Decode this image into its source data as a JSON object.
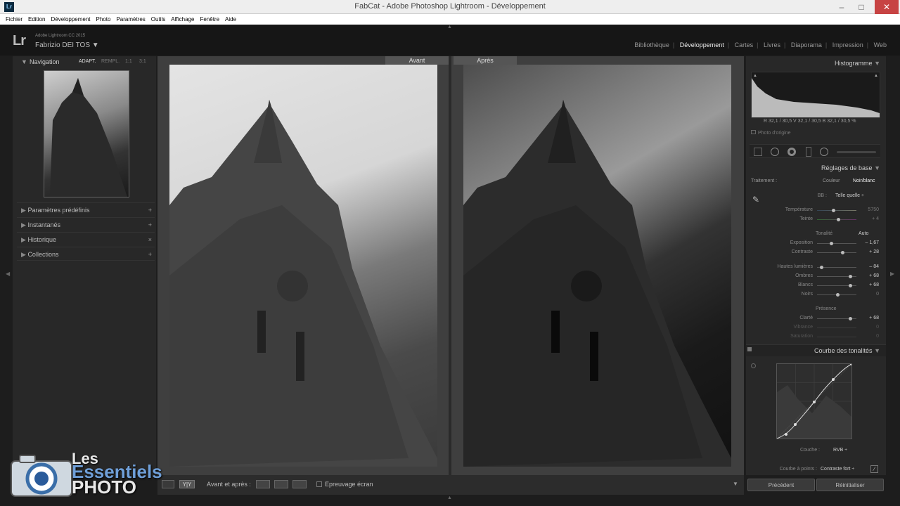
{
  "window": {
    "title": "FabCat - Adobe Photoshop Lightroom - Développement",
    "minimize": "–",
    "maximize": "□",
    "close": "✕"
  },
  "menu": [
    "Fichier",
    "Edition",
    "Développement",
    "Photo",
    "Paramètres",
    "Outils",
    "Affichage",
    "Fenêtre",
    "Aide"
  ],
  "identity": {
    "logo": "Lr",
    "version": "Adobe Lightroom CC 2015",
    "user": "Fabrizio DEI TOS ▼"
  },
  "modules": [
    "Bibliothèque",
    "Développement",
    "Cartes",
    "Livres",
    "Diaporama",
    "Impression",
    "Web"
  ],
  "left": {
    "navigator": {
      "title": "Navigation",
      "zoom": [
        "ADAPT.",
        "REMPL.",
        "1:1",
        "3:1"
      ]
    },
    "sections": [
      {
        "label": "Paramètres prédéfinis",
        "action": "+"
      },
      {
        "label": "Instantanés",
        "action": "+"
      },
      {
        "label": "Historique",
        "action": "×"
      },
      {
        "label": "Collections",
        "action": "+"
      }
    ]
  },
  "compare": {
    "before": "Avant",
    "after": "Après"
  },
  "toolbar": {
    "view_label": "Y|Y",
    "ba_label": "Avant et après :",
    "proof": "Epreuvage écran",
    "menu_arrow": "▼"
  },
  "right": {
    "histogram": {
      "title": "Histogramme",
      "readout": "R 32,1 / 30,5 V 32,1 / 30,5 B 32,1 / 30,5 %",
      "original": "Photo d'origine"
    },
    "basic": {
      "title": "Réglages de base",
      "treatment_label": "Traitement :",
      "color": "Couleur",
      "bw": "Noir/blanc",
      "wb_label": "BB :",
      "wb_value": "Telle quelle ÷",
      "temp": {
        "label": "Température",
        "value": "5750"
      },
      "tint": {
        "label": "Teinte",
        "value": "+ 4"
      },
      "tone_label": "Tonalité",
      "auto": "Auto",
      "exposure": {
        "label": "Exposition",
        "value": "– 1,67"
      },
      "contrast": {
        "label": "Contraste",
        "value": "+ 28"
      },
      "highlights": {
        "label": "Hautes lumières",
        "value": "– 84"
      },
      "shadows": {
        "label": "Ombres",
        "value": "+ 68"
      },
      "whites": {
        "label": "Blancs",
        "value": "+ 68"
      },
      "blacks": {
        "label": "Noirs",
        "value": "0"
      },
      "presence_label": "Présence",
      "clarity": {
        "label": "Clarté",
        "value": "+ 68"
      },
      "vibrance": {
        "label": "Vibrance",
        "value": "0"
      },
      "saturation": {
        "label": "Saturation",
        "value": "0"
      }
    },
    "curve": {
      "title": "Courbe des tonalités",
      "channel_label": "Couche :",
      "channel": "RVB ÷",
      "point_curve_label": "Courbe à points :",
      "point_curve": "Contraste fort ÷"
    },
    "buttons": {
      "prev": "Précédent",
      "reset": "Réinitialiser"
    }
  },
  "watermark": {
    "line1": "Les",
    "line2": "Essentiels",
    "line3": "PHOTO"
  }
}
